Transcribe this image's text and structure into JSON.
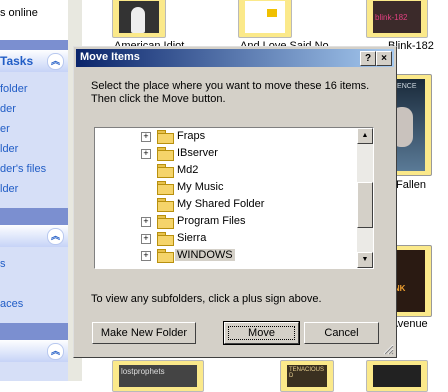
{
  "background": {
    "status_text": "s online",
    "tasks_panel_title": "Tasks",
    "tasks": [
      "folder",
      "der",
      "er",
      "lder",
      "der's files",
      "lder"
    ],
    "other_panel_items": [
      "s",
      "aces"
    ],
    "albums_top": [
      {
        "label": "American Idiot"
      },
      {
        "label": "And Love Said No"
      },
      {
        "label": "Blink-182"
      }
    ],
    "albums_side": [
      {
        "label": "Fallen"
      },
      {
        "label": "n Avenue"
      }
    ],
    "cover_texts": {
      "evanescence": "VESCENCE",
      "blink": "blink-182",
      "lostprophets": "lostprophets",
      "tenacious": "TENACIOUS D",
      "mid": "BLINK"
    }
  },
  "dialog": {
    "title": "Move Items",
    "help_button": "?",
    "close_button": "×",
    "instruction_line1": "Select the place where you want to move these 16 items.",
    "instruction_line2": "Then click the Move button.",
    "tree": [
      {
        "label": "Fraps",
        "expandable": true,
        "selected": false
      },
      {
        "label": "IBserver",
        "expandable": true,
        "selected": false
      },
      {
        "label": "Md2",
        "expandable": false,
        "selected": false
      },
      {
        "label": "My Music",
        "expandable": false,
        "selected": false
      },
      {
        "label": "My Shared Folder",
        "expandable": false,
        "selected": false
      },
      {
        "label": "Program Files",
        "expandable": true,
        "selected": false
      },
      {
        "label": "Sierra",
        "expandable": true,
        "selected": false
      },
      {
        "label": "WINDOWS",
        "expandable": true,
        "selected": true
      }
    ],
    "hint": "To view any subfolders, click a plus sign above.",
    "make_new_folder_button": "Make New Folder",
    "move_button": "Move",
    "cancel_button": "Cancel"
  },
  "colors": {
    "titlebar_start": "#0a246a",
    "titlebar_end": "#a6caf0",
    "dialog_face": "#d4d0c8",
    "taskpane_link": "#215dc6"
  }
}
